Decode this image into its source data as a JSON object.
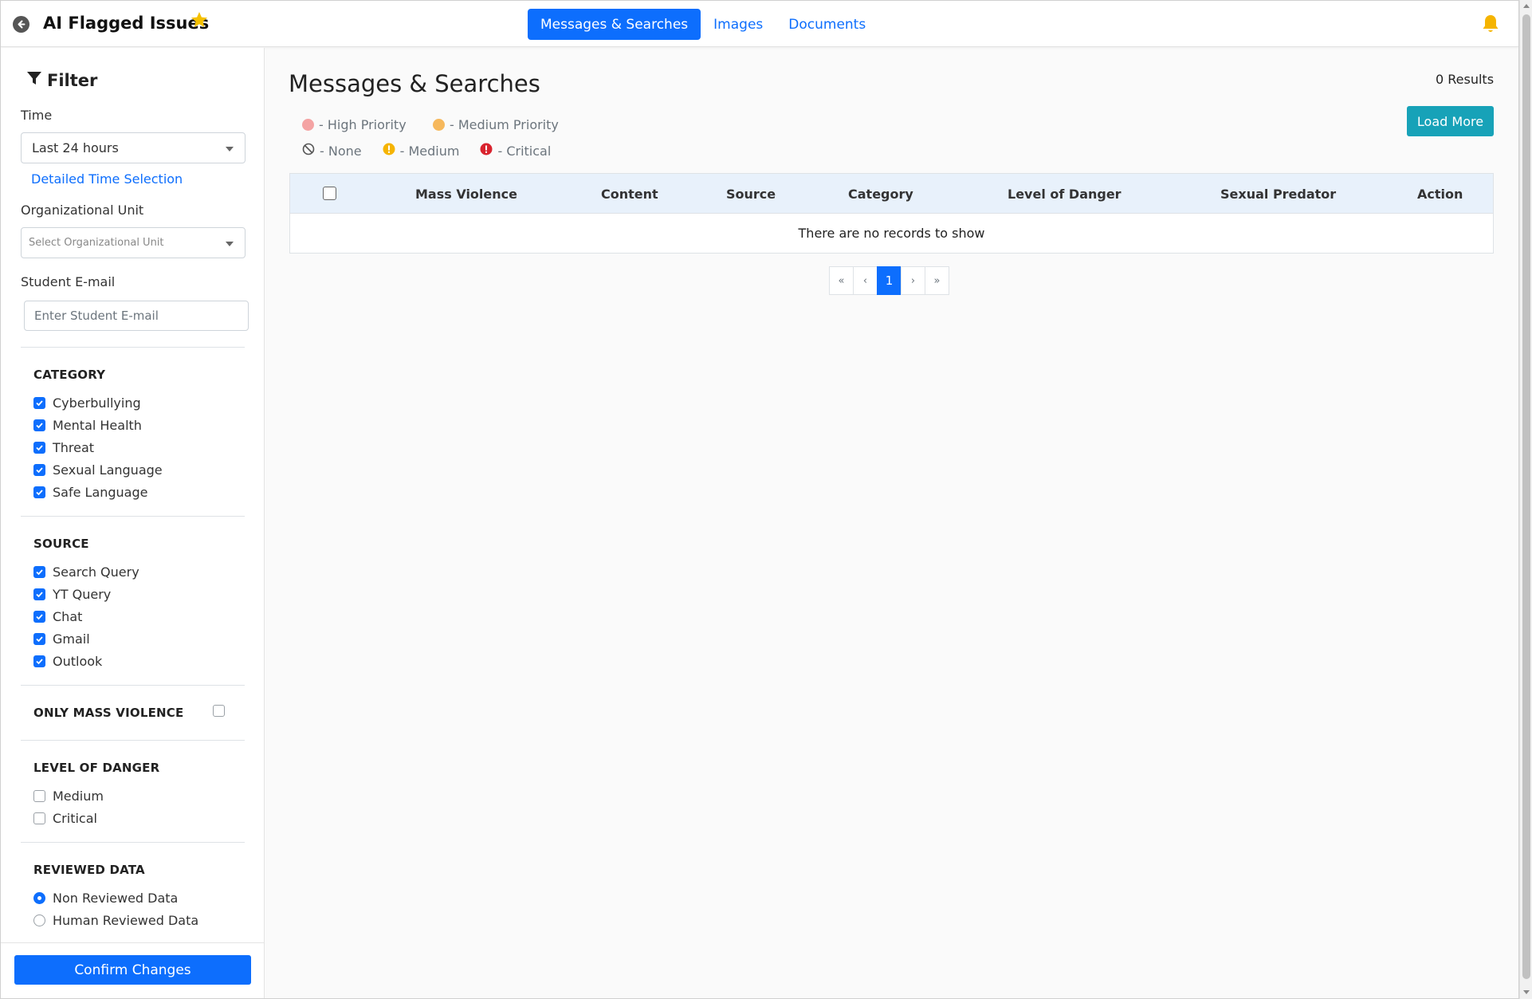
{
  "header": {
    "title": "AI Flagged Issues",
    "tabs": [
      {
        "label": "Messages & Searches",
        "active": true
      },
      {
        "label": "Images",
        "active": false
      },
      {
        "label": "Documents",
        "active": false
      }
    ]
  },
  "sidebar": {
    "filter_title": "Filter",
    "time_label": "Time",
    "time_value": "Last 24 hours",
    "detailed_time_link": "Detailed Time Selection",
    "org_unit_label": "Organizational Unit",
    "org_unit_placeholder": "Select Organizational Unit",
    "email_label": "Student E-mail",
    "email_placeholder": "Enter Student E-mail",
    "category": {
      "title": "CATEGORY",
      "items": [
        {
          "label": "Cyberbullying",
          "checked": true
        },
        {
          "label": "Mental Health",
          "checked": true
        },
        {
          "label": "Threat",
          "checked": true
        },
        {
          "label": "Sexual Language",
          "checked": true
        },
        {
          "label": "Safe Language",
          "checked": true
        }
      ]
    },
    "source": {
      "title": "SOURCE",
      "items": [
        {
          "label": "Search Query",
          "checked": true
        },
        {
          "label": "YT Query",
          "checked": true
        },
        {
          "label": "Chat",
          "checked": true
        },
        {
          "label": "Gmail",
          "checked": true
        },
        {
          "label": "Outlook",
          "checked": true
        }
      ]
    },
    "mass_violence": {
      "title": "ONLY MASS VIOLENCE",
      "checked": false
    },
    "level_of_danger": {
      "title": "LEVEL OF DANGER",
      "items": [
        {
          "label": "Medium",
          "checked": false
        },
        {
          "label": "Critical",
          "checked": false
        }
      ]
    },
    "reviewed_data": {
      "title": "REVIEWED DATA",
      "items": [
        {
          "label": "Non Reviewed Data",
          "selected": true
        },
        {
          "label": "Human Reviewed Data",
          "selected": false
        }
      ]
    },
    "confirm_label": "Confirm Changes"
  },
  "main": {
    "title": "Messages & Searches",
    "results": "0 Results",
    "load_more": "Load More",
    "legend": {
      "high": "- High Priority",
      "medium_priority": "- Medium Priority",
      "none": "- None",
      "medium": "- Medium",
      "critical": "- Critical"
    },
    "colors": {
      "high_priority": "#f4a3a3",
      "medium_priority": "#f6b85c",
      "medium_icon": "#f5b400",
      "critical_icon": "#d9232e",
      "primary": "#0d6efd",
      "load_more": "#17a2b8"
    },
    "table": {
      "columns": [
        "Mass Violence",
        "Content",
        "Source",
        "Category",
        "Level of Danger",
        "Sexual Predator",
        "Action"
      ],
      "empty_message": "There are no records to show"
    },
    "pagination": {
      "first": "«",
      "prev": "‹",
      "current": "1",
      "next": "›",
      "last": "»"
    }
  }
}
